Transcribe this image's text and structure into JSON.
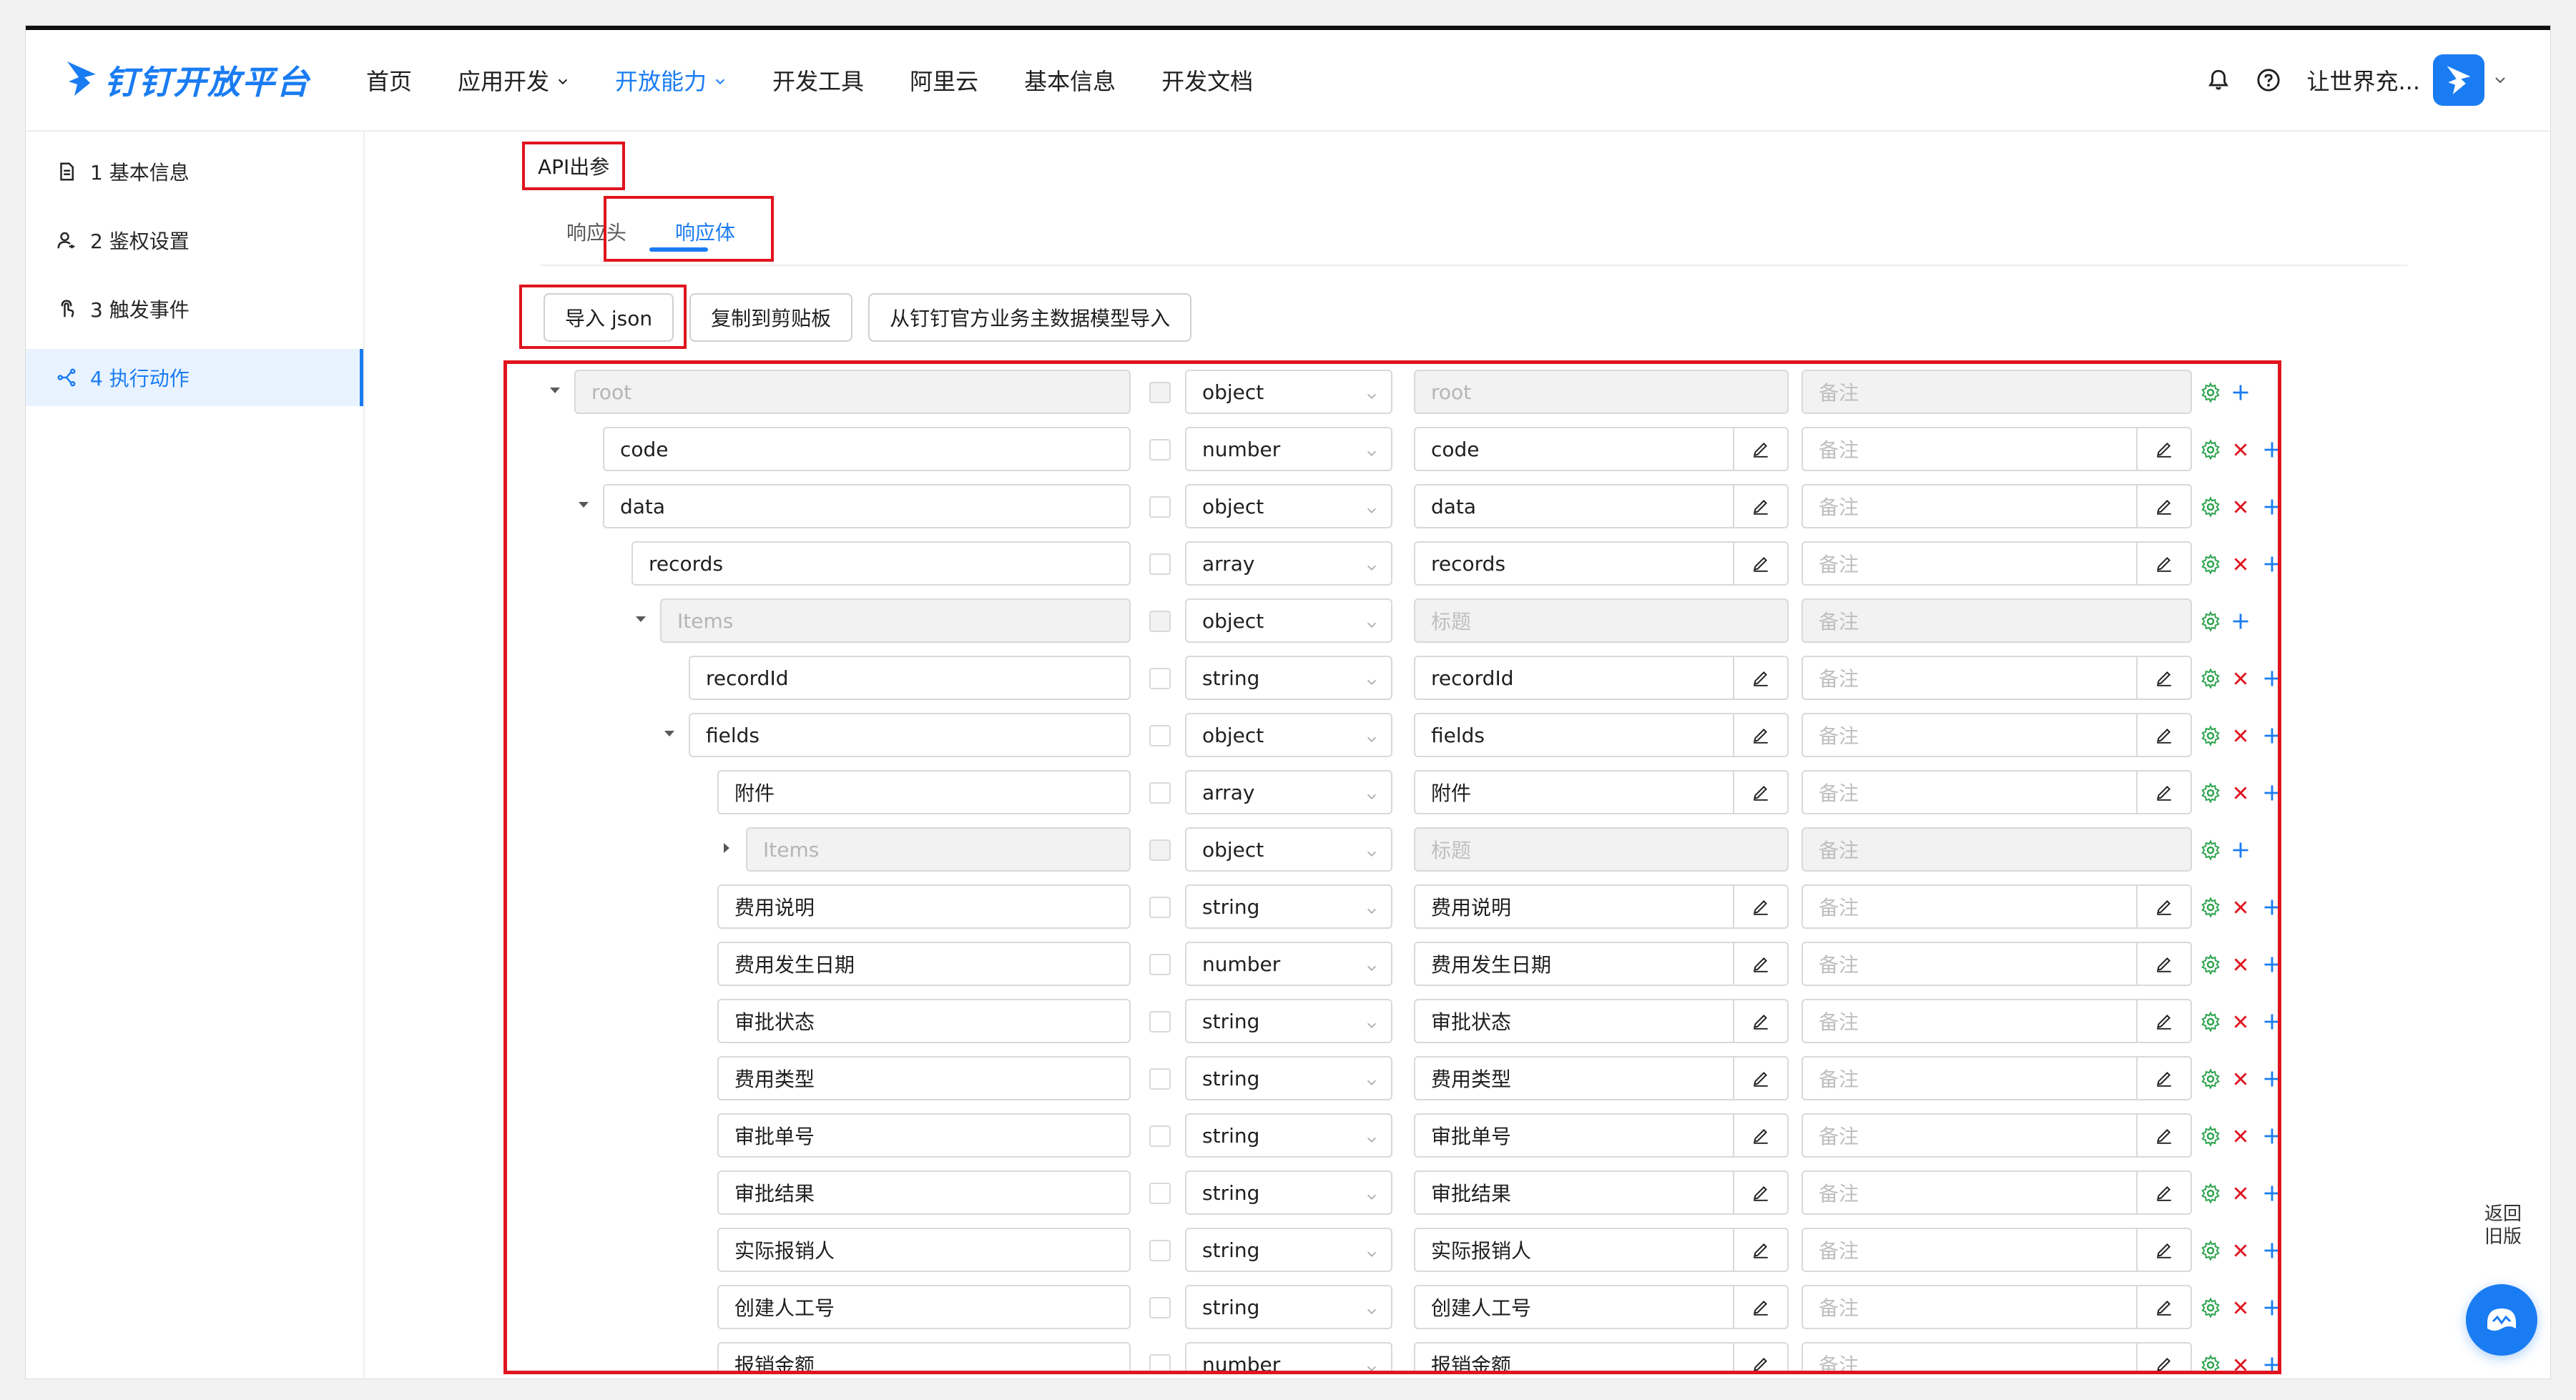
{
  "header": {
    "logo_text": "钉钉开放平台",
    "nav": [
      {
        "label": "首页",
        "active": false,
        "dropdown": false
      },
      {
        "label": "应用开发",
        "active": false,
        "dropdown": true
      },
      {
        "label": "开放能力",
        "active": true,
        "dropdown": true
      },
      {
        "label": "开发工具",
        "active": false,
        "dropdown": false
      },
      {
        "label": "阿里云",
        "active": false,
        "dropdown": false
      },
      {
        "label": "基本信息",
        "active": false,
        "dropdown": false
      },
      {
        "label": "开发文档",
        "active": false,
        "dropdown": false
      }
    ],
    "icons": [
      "bell-icon",
      "help-icon"
    ],
    "username": "让世界充...",
    "accent_color": "#1a7cf2"
  },
  "sidebar": {
    "items": [
      {
        "label": "1 基本信息",
        "icon": "document-icon",
        "active": false
      },
      {
        "label": "2 鉴权设置",
        "icon": "user-key-icon",
        "active": false
      },
      {
        "label": "3 触发事件",
        "icon": "touch-icon",
        "active": false
      },
      {
        "label": "4 执行动作",
        "icon": "flow-icon",
        "active": true
      }
    ]
  },
  "main": {
    "section_title": "API出参",
    "tabs": [
      {
        "label": "响应头",
        "active": false
      },
      {
        "label": "响应体",
        "active": true
      }
    ],
    "buttons": {
      "import_json": "导入 json",
      "copy": "复制到剪贴板",
      "import_model": "从钉钉官方业务主数据模型导入"
    },
    "placeholders": {
      "title": "标题",
      "remark": "备注"
    },
    "rows": [
      {
        "name": "root",
        "type": "object",
        "title": "root",
        "level": 0,
        "caret": "down",
        "disabled": true,
        "deletable": false
      },
      {
        "name": "code",
        "type": "number",
        "title": "code",
        "level": 1,
        "caret": "",
        "disabled": false,
        "deletable": true
      },
      {
        "name": "data",
        "type": "object",
        "title": "data",
        "level": 1,
        "caret": "down",
        "disabled": false,
        "deletable": true
      },
      {
        "name": "records",
        "type": "array",
        "title": "records",
        "level": 2,
        "caret": "",
        "disabled": false,
        "deletable": true
      },
      {
        "name": "Items",
        "type": "object",
        "title": "",
        "level": 3,
        "caret": "down",
        "disabled": true,
        "deletable": false
      },
      {
        "name": "recordId",
        "type": "string",
        "title": "recordId",
        "level": 4,
        "caret": "",
        "disabled": false,
        "deletable": true
      },
      {
        "name": "fields",
        "type": "object",
        "title": "fields",
        "level": 4,
        "caret": "down",
        "disabled": false,
        "deletable": true
      },
      {
        "name": "附件",
        "type": "array",
        "title": "附件",
        "level": 5,
        "caret": "",
        "disabled": false,
        "deletable": true
      },
      {
        "name": "Items",
        "type": "object",
        "title": "",
        "level": 6,
        "caret": "right",
        "disabled": true,
        "deletable": false
      },
      {
        "name": "费用说明",
        "type": "string",
        "title": "费用说明",
        "level": 5,
        "caret": "",
        "disabled": false,
        "deletable": true
      },
      {
        "name": "费用发生日期",
        "type": "number",
        "title": "费用发生日期",
        "level": 5,
        "caret": "",
        "disabled": false,
        "deletable": true
      },
      {
        "name": "审批状态",
        "type": "string",
        "title": "审批状态",
        "level": 5,
        "caret": "",
        "disabled": false,
        "deletable": true
      },
      {
        "name": "费用类型",
        "type": "string",
        "title": "费用类型",
        "level": 5,
        "caret": "",
        "disabled": false,
        "deletable": true
      },
      {
        "name": "审批单号",
        "type": "string",
        "title": "审批单号",
        "level": 5,
        "caret": "",
        "disabled": false,
        "deletable": true
      },
      {
        "name": "审批结果",
        "type": "string",
        "title": "审批结果",
        "level": 5,
        "caret": "",
        "disabled": false,
        "deletable": true
      },
      {
        "name": "实际报销人",
        "type": "string",
        "title": "实际报销人",
        "level": 5,
        "caret": "",
        "disabled": false,
        "deletable": true
      },
      {
        "name": "创建人工号",
        "type": "string",
        "title": "创建人工号",
        "level": 5,
        "caret": "",
        "disabled": false,
        "deletable": true
      },
      {
        "name": "报销金额",
        "type": "number",
        "title": "报销金额",
        "level": 5,
        "caret": "",
        "disabled": false,
        "deletable": true
      }
    ]
  },
  "floating": {
    "back_old_line1": "返回",
    "back_old_line2": "旧版"
  },
  "colors": {
    "highlight_box": "#e0141e",
    "settings_icon": "#2ea44f",
    "delete_icon": "#e0141e",
    "add_icon": "#1a7cf2"
  }
}
